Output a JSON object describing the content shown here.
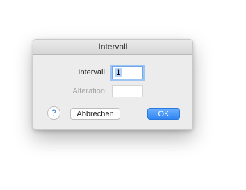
{
  "dialog": {
    "title": "Intervall",
    "fields": {
      "intervall": {
        "label": "Intervall:",
        "value": "1"
      },
      "alteration": {
        "label": "Alteration:",
        "value": ""
      }
    },
    "help_label": "?",
    "cancel_label": "Abbrechen",
    "ok_label": "OK"
  },
  "colors": {
    "accent": "#3b8cf5",
    "disabled_text": "#a6a6a6"
  }
}
